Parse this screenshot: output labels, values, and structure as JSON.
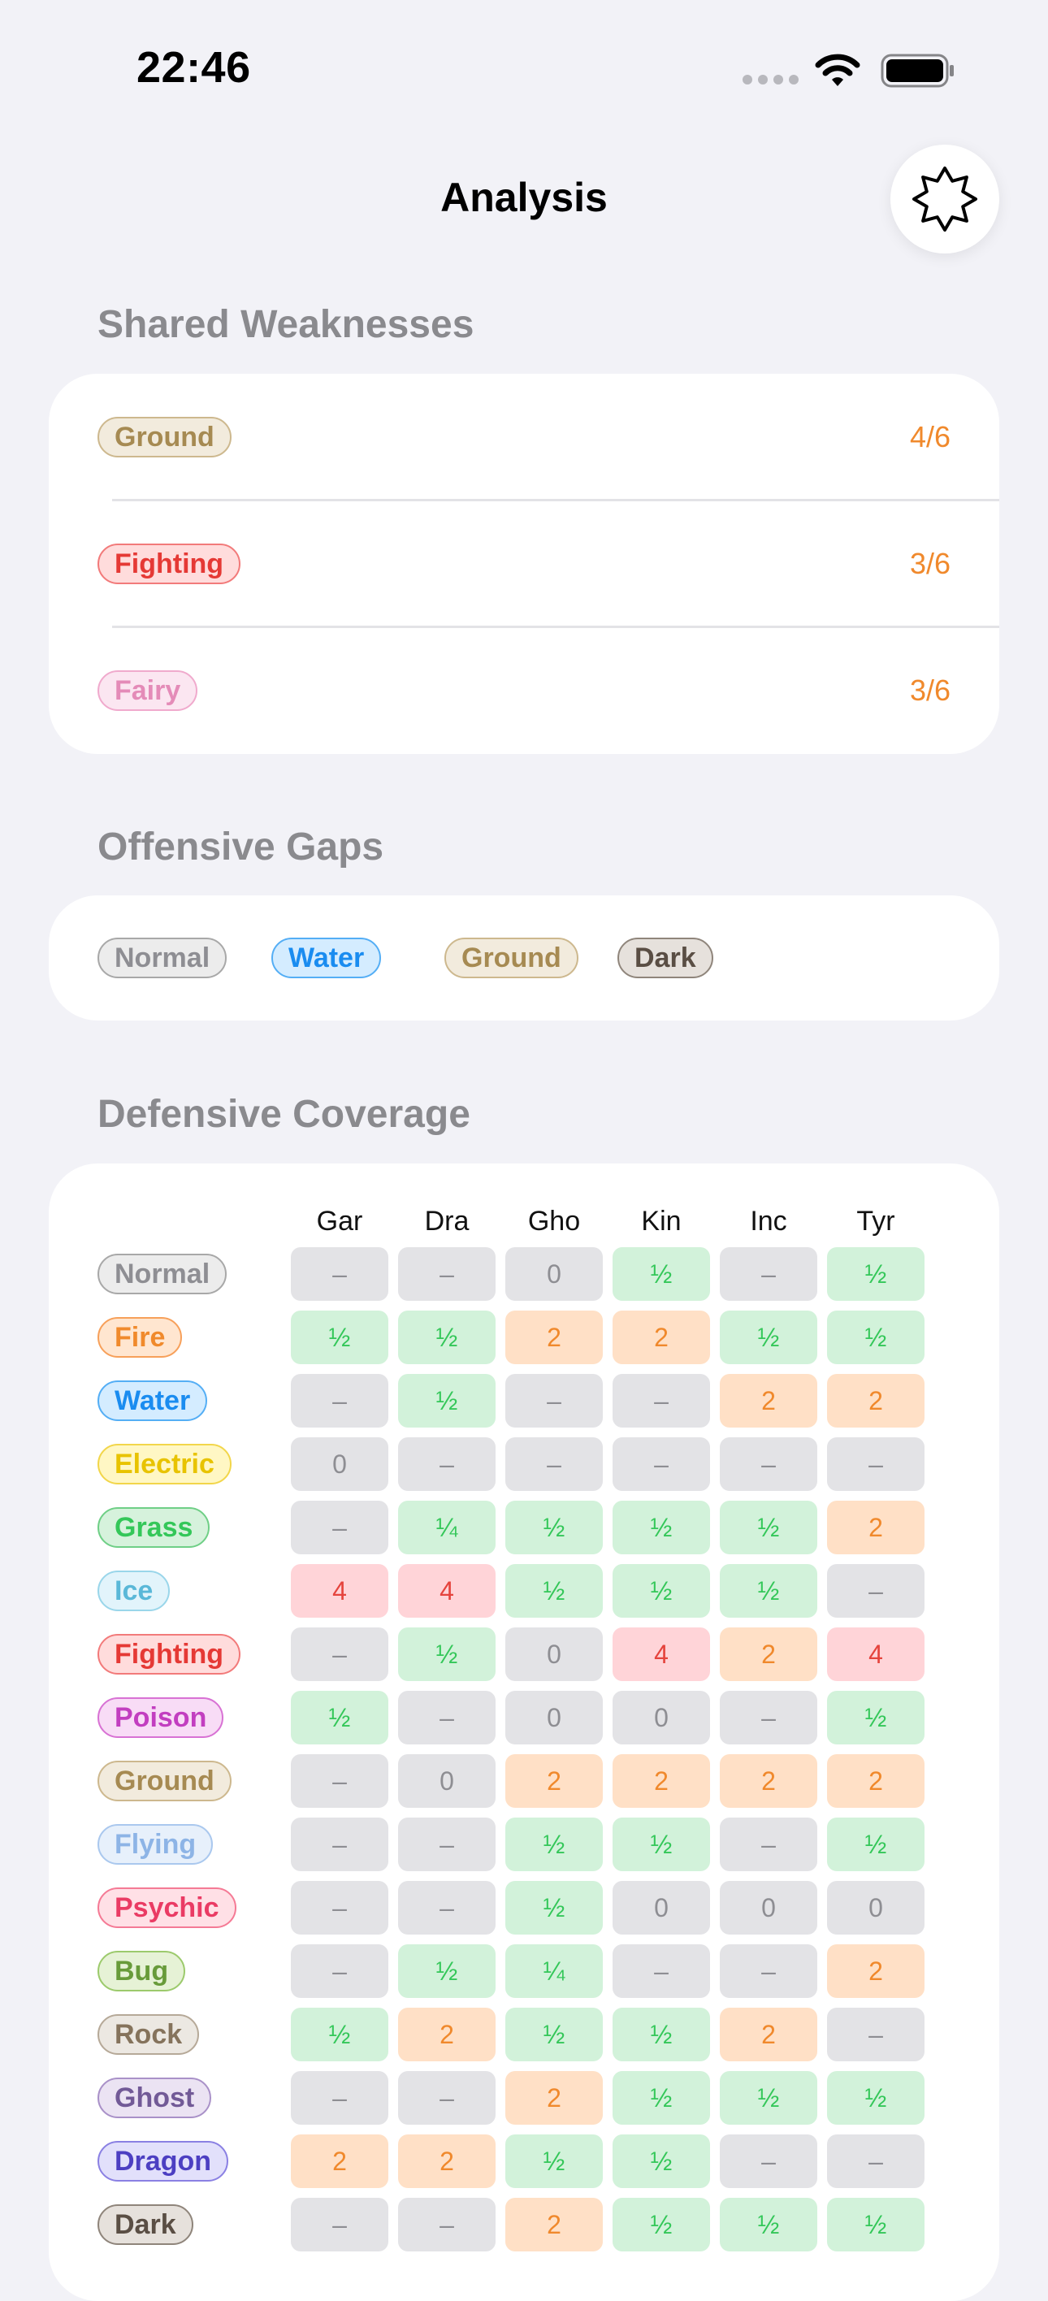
{
  "status_bar": {
    "time": "22:46"
  },
  "nav": {
    "title": "Analysis",
    "action_icon": "star-badge-icon"
  },
  "shared_weaknesses": {
    "title": "Shared Weaknesses",
    "items": [
      {
        "type": "Ground",
        "count": "4/6"
      },
      {
        "type": "Fighting",
        "count": "3/6"
      },
      {
        "type": "Fairy",
        "count": "3/6"
      }
    ]
  },
  "offensive_gaps": {
    "title": "Offensive Gaps",
    "types": [
      "Normal",
      "Water",
      "Ground",
      "Dark"
    ]
  },
  "defensive_coverage": {
    "title": "Defensive Coverage",
    "columns": [
      "Gar",
      "Dra",
      "Gho",
      "Kin",
      "Inc",
      "Tyr"
    ],
    "rows": [
      {
        "type": "Normal",
        "values": [
          "–",
          "–",
          "0",
          "½",
          "–",
          "½"
        ]
      },
      {
        "type": "Fire",
        "values": [
          "½",
          "½",
          "2",
          "2",
          "½",
          "½"
        ]
      },
      {
        "type": "Water",
        "values": [
          "–",
          "½",
          "–",
          "–",
          "2",
          "2"
        ]
      },
      {
        "type": "Electric",
        "values": [
          "0",
          "–",
          "–",
          "–",
          "–",
          "–"
        ]
      },
      {
        "type": "Grass",
        "values": [
          "–",
          "¼",
          "½",
          "½",
          "½",
          "2"
        ]
      },
      {
        "type": "Ice",
        "values": [
          "4",
          "4",
          "½",
          "½",
          "½",
          "–"
        ]
      },
      {
        "type": "Fighting",
        "values": [
          "–",
          "½",
          "0",
          "4",
          "2",
          "4"
        ]
      },
      {
        "type": "Poison",
        "values": [
          "½",
          "–",
          "0",
          "0",
          "–",
          "½"
        ]
      },
      {
        "type": "Ground",
        "values": [
          "–",
          "0",
          "2",
          "2",
          "2",
          "2"
        ]
      },
      {
        "type": "Flying",
        "values": [
          "–",
          "–",
          "½",
          "½",
          "–",
          "½"
        ]
      },
      {
        "type": "Psychic",
        "values": [
          "–",
          "–",
          "½",
          "0",
          "0",
          "0"
        ]
      },
      {
        "type": "Bug",
        "values": [
          "–",
          "½",
          "¼",
          "–",
          "–",
          "2"
        ]
      },
      {
        "type": "Rock",
        "values": [
          "½",
          "2",
          "½",
          "½",
          "2",
          "–"
        ]
      },
      {
        "type": "Ghost",
        "values": [
          "–",
          "–",
          "2",
          "½",
          "½",
          "½"
        ]
      },
      {
        "type": "Dragon",
        "values": [
          "2",
          "2",
          "½",
          "½",
          "–",
          "–"
        ]
      },
      {
        "type": "Dark",
        "values": [
          "–",
          "–",
          "2",
          "½",
          "½",
          "½"
        ]
      }
    ]
  },
  "type_colors": {
    "Normal": {
      "bg": "#ececec",
      "border": "#a8a8a8",
      "text": "#8e8e93"
    },
    "Fire": {
      "bg": "#ffe6d0",
      "border": "#f7a05a",
      "text": "#f08a2c"
    },
    "Water": {
      "bg": "#d4ecff",
      "border": "#54aef5",
      "text": "#1a8cf0"
    },
    "Electric": {
      "bg": "#fff7c4",
      "border": "#f2d64a",
      "text": "#e8c300"
    },
    "Grass": {
      "bg": "#d6f2dc",
      "border": "#6fcf86",
      "text": "#34c759"
    },
    "Ice": {
      "bg": "#e2f4fb",
      "border": "#9ad6ea",
      "text": "#5ab8d8"
    },
    "Fighting": {
      "bg": "#ffdcdc",
      "border": "#f27a7a",
      "text": "#e53935"
    },
    "Poison": {
      "bg": "#f8dcf6",
      "border": "#d872d4",
      "text": "#c23ec0"
    },
    "Ground": {
      "bg": "#f2ebdd",
      "border": "#cdb88e",
      "text": "#a68a52"
    },
    "Flying": {
      "bg": "#e7f0fb",
      "border": "#aac8ee",
      "text": "#8db4e6"
    },
    "Psychic": {
      "bg": "#ffe0e6",
      "border": "#f57a95",
      "text": "#ea3b64"
    },
    "Bug": {
      "bg": "#e6f2d6",
      "border": "#9cca6c",
      "text": "#689b3a"
    },
    "Rock": {
      "bg": "#ece8e2",
      "border": "#b6a998",
      "text": "#85735c"
    },
    "Ghost": {
      "bg": "#ebe3f3",
      "border": "#a991c8",
      "text": "#725a97"
    },
    "Dragon": {
      "bg": "#e2e0fb",
      "border": "#8a80e3",
      "text": "#4c3fc2"
    },
    "Dark": {
      "bg": "#e6e1dc",
      "border": "#8f857b",
      "text": "#5a4e44"
    },
    "Fairy": {
      "bg": "#fbe6f1",
      "border": "#f0aacd",
      "text": "#e48bb8"
    }
  },
  "cell_colors": {
    "neutral": "#e3e3e6",
    "resist": "#d2f2da",
    "weak": "#ffe0c6",
    "double_weak": "#ffd4d8",
    "weak_text": "#f0892c"
  }
}
